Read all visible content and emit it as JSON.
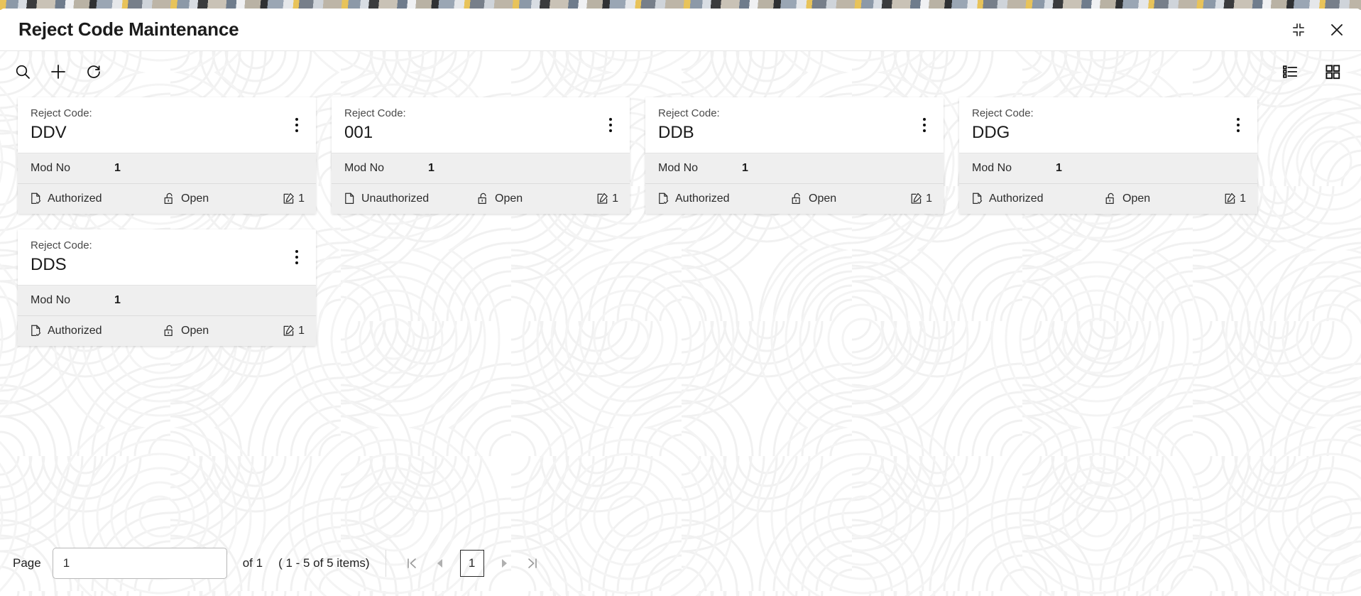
{
  "window": {
    "title": "Reject Code Maintenance",
    "actions": [
      {
        "name": "restore-down-icon",
        "label": "Restore Down"
      },
      {
        "name": "close-icon",
        "label": "Close"
      }
    ]
  },
  "toolbar": {
    "left": [
      {
        "name": "search-icon",
        "label": "Search"
      },
      {
        "name": "add-icon",
        "label": "Add"
      },
      {
        "name": "refresh-icon",
        "label": "Refresh"
      }
    ],
    "right": [
      {
        "name": "list-view-icon",
        "label": "List View"
      },
      {
        "name": "grid-view-icon",
        "label": "Grid View"
      }
    ]
  },
  "card_labels": {
    "code_label": "Reject Code:",
    "mod_key": "Mod No"
  },
  "cards": [
    {
      "code": "DDV",
      "mod_no": "1",
      "auth_status": "Authorized",
      "auth_icon": "document-check-icon",
      "lock_status": "Open",
      "lock_icon": "unlock-icon",
      "edit_count": "1",
      "edit_icon": "edit-square-icon"
    },
    {
      "code": "001",
      "mod_no": "1",
      "auth_status": "Unauthorized",
      "auth_icon": "document-icon",
      "lock_status": "Open",
      "lock_icon": "unlock-icon",
      "edit_count": "1",
      "edit_icon": "edit-square-icon"
    },
    {
      "code": "DDB",
      "mod_no": "1",
      "auth_status": "Authorized",
      "auth_icon": "document-check-icon",
      "lock_status": "Open",
      "lock_icon": "unlock-icon",
      "edit_count": "1",
      "edit_icon": "edit-square-icon"
    },
    {
      "code": "DDG",
      "mod_no": "1",
      "auth_status": "Authorized",
      "auth_icon": "document-check-icon",
      "lock_status": "Open",
      "lock_icon": "unlock-icon",
      "edit_count": "1",
      "edit_icon": "edit-square-icon"
    },
    {
      "code": "DDS",
      "mod_no": "1",
      "auth_status": "Authorized",
      "auth_icon": "document-check-icon",
      "lock_status": "Open",
      "lock_icon": "unlock-icon",
      "edit_count": "1",
      "edit_icon": "edit-square-icon"
    }
  ],
  "pagination": {
    "page_label": "Page",
    "page_value": "1",
    "of_text": "of 1",
    "items_text": "( 1 - 5 of 5 items)",
    "current_page": "1",
    "first_label": "First",
    "prev_label": "Previous",
    "next_label": "Next",
    "last_label": "Last"
  },
  "colors": {
    "card_header_bg": "#ffffff",
    "card_body_bg": "#efefef",
    "text": "#1c1c1c",
    "muted": "#9a9a9a",
    "accent_strip": "#e8c35a"
  }
}
